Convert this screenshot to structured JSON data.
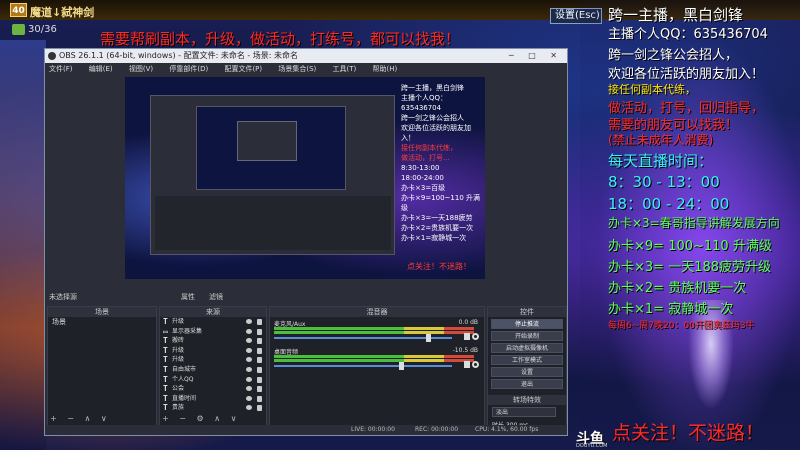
{
  "game": {
    "level": "40",
    "player_name": "魔道↓弑神剑",
    "count": "30/36",
    "settings_label": "设置(Esc)",
    "banner": "需要帮刷副本，升级，做活动，打练号，都可以找我！"
  },
  "obs": {
    "title": "OBS 26.1.1 (64-bit, windows) - 配置文件: 未命名 - 场景: 未命名",
    "menu": [
      "文件(F)",
      "编辑(E)",
      "视图(V)",
      "停靠部件(D)",
      "配置文件(P)",
      "场景集合(S)",
      "工具(T)",
      "帮助(H)"
    ],
    "preview": {
      "lines": [
        "跨一主播，黑白剑锋",
        "主播个人QQ：635436704",
        "跨一剑之锋公会招人",
        "欢迎各位活跃的朋友加入！",
        "接任何副本代练，",
        "做活动，打号...",
        "8:30-13:00",
        "18:00-24:00",
        "办卡×3=百级",
        "办卡×9=100~110 升满级",
        "办卡×3=一天188疲劳",
        "办卡×2=贵族机要一次",
        "办卡×1=寂静城一次"
      ],
      "bottom": "点关注！不迷路！"
    },
    "status_row": {
      "text": "未选择源",
      "properties": "属性",
      "filters": "滤镜"
    },
    "docks": {
      "scenes": {
        "header": "场景",
        "items": [
          "场景"
        ],
        "footer": "+ − ∧ ∨"
      },
      "sources": {
        "header": "来源",
        "items": [
          "升级",
          "显示器采集",
          "搬砖",
          "升级",
          "升级",
          "自由城市",
          "个人QQ",
          "公会",
          "直播时间",
          "贵族"
        ],
        "footer": "+ − ⚙ ∧ ∨"
      },
      "mixer": {
        "header": "混音器",
        "tracks": [
          {
            "label": "麦克风/Aux",
            "db": "0.0 dB",
            "level": 0.88
          },
          {
            "label": "桌面音频",
            "db": "-10.5 dB",
            "level": 0.72
          }
        ]
      },
      "controls": {
        "header": "控件",
        "buttons": [
          "停止推流",
          "开始录制",
          "启动虚拟摄像机",
          "工作室模式",
          "设置",
          "退出"
        ],
        "transitions_header": "转场特效",
        "transition_value": "淡出",
        "duration_label": "时长",
        "duration_value": "300 ms"
      }
    },
    "statusbar": {
      "live": "LIVE: 00:00:00",
      "rec": "REC: 00:00:00",
      "cpu": "CPU: 4.1%, 60.00 fps"
    }
  },
  "overlay": {
    "lines": [
      {
        "text": "跨一主播，黑白剑锋",
        "color": "white"
      },
      {
        "text": "主播个人QQ：635436704",
        "color": "white"
      },
      {
        "text": "跨一剑之锋公会招人，",
        "color": "white"
      },
      {
        "text": "欢迎各位活跃的朋友加入！",
        "color": "white"
      },
      {
        "text": "接任何副本代练，",
        "color": "yellow"
      },
      {
        "text": "做活动，打号，回归指导，",
        "color": "red"
      },
      {
        "text": "需要的朋友可以找我！",
        "color": "red"
      },
      {
        "text": "(禁止未成年人消费)",
        "color": "red"
      },
      {
        "text": "每天直播时间：",
        "color": "cyan"
      },
      {
        "text": "8：30 - 13：00",
        "color": "cyan"
      },
      {
        "text": "18：00 - 24：00",
        "color": "cyan"
      },
      {
        "text": "办卡×3=春哥指导讲解发展方向",
        "color": "green"
      },
      {
        "text": "办卡×9= 100~110 升满级",
        "color": "green"
      },
      {
        "text": "办卡×3= 一天188疲劳升级",
        "color": "green"
      },
      {
        "text": "办卡×2= 贵族机要一次",
        "color": "green"
      },
      {
        "text": "办卡×1= 寂静城一次",
        "color": "green"
      },
      {
        "text": "每周6~周7晚20：00开团奥兹玛3牛",
        "color": "red"
      }
    ],
    "follow": "点关注！不迷路！",
    "douyu": "斗鱼",
    "douyu_sub": "DOUYU.COM"
  }
}
